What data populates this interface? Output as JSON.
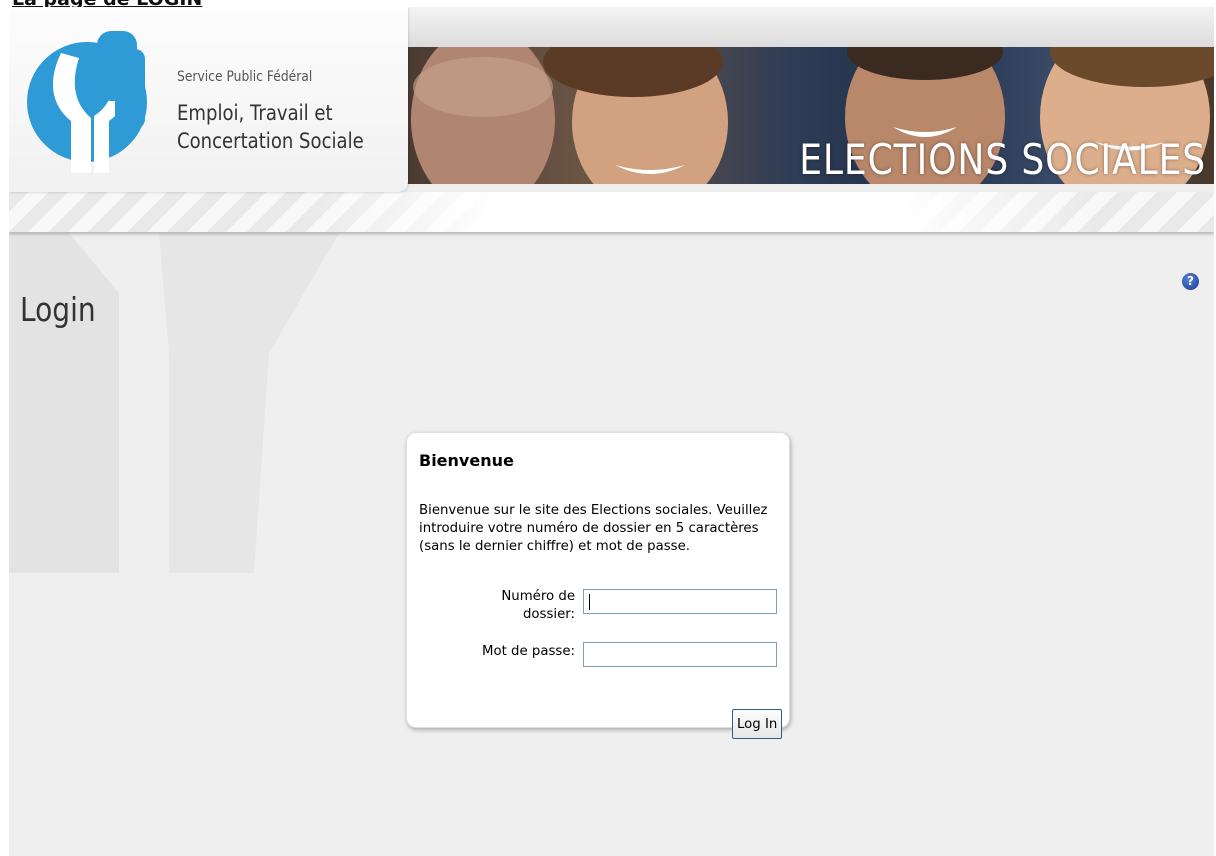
{
  "document_heading": "La page de LOGIN",
  "header": {
    "org_line1": "Service Public Fédéral",
    "org_line2": "Emploi, Travail et",
    "org_line3": "Concertation Sociale",
    "banner_title": "ELECTIONS SOCIALES",
    "logo_color": "#2e9ad6"
  },
  "page": {
    "title": "Login",
    "help_icon": "question-icon",
    "help_glyph": "?"
  },
  "login_box": {
    "title": "Bienvenue",
    "intro": "Bienvenue sur le site des Elections sociales. Veuillez introduire votre numéro de dossier en 5 caractères (sans le dernier chiffre) et mot de passe.",
    "dossier_label": "Numéro de dossier:",
    "dossier_value": "",
    "password_label": "Mot de passe:",
    "password_value": "",
    "button_label": "Log In"
  }
}
